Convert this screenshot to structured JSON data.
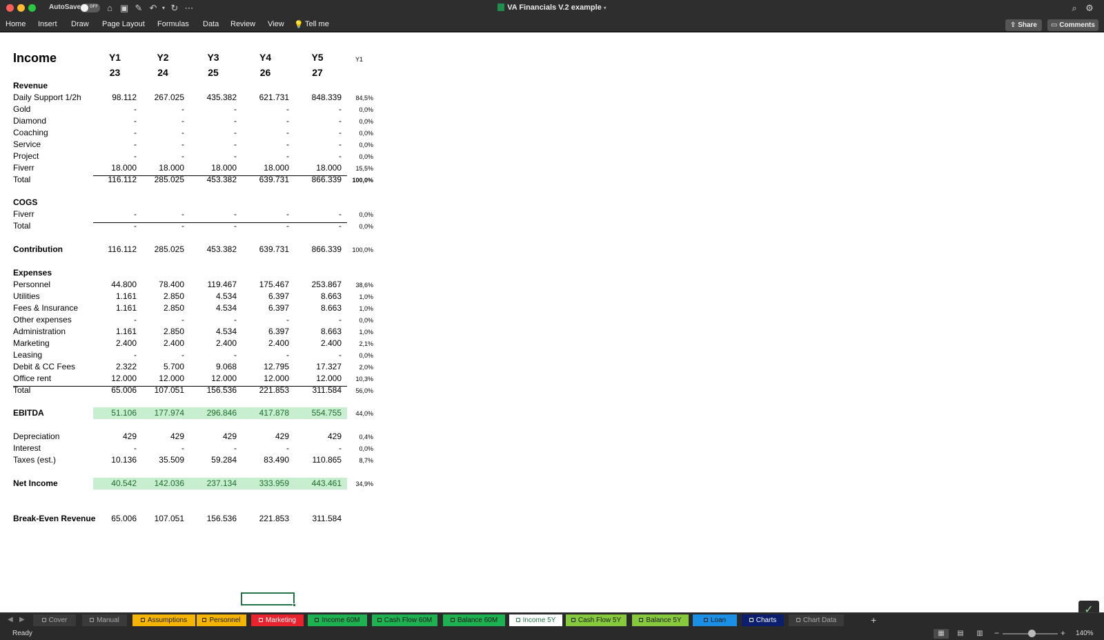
{
  "window": {
    "title": "VA Financials V.2 example",
    "autosave_label": "AutoSave",
    "autosave_state": "OFF"
  },
  "ribbon": {
    "menu": [
      "Home",
      "Insert",
      "Draw",
      "Page Layout",
      "Formulas",
      "Data",
      "Review",
      "View",
      "Tell me"
    ],
    "share_label": "Share",
    "comments_label": "Comments"
  },
  "sheet": {
    "title": "Income",
    "year_headers": [
      "Y1",
      "Y2",
      "Y3",
      "Y4",
      "Y5"
    ],
    "years": [
      "23",
      "24",
      "25",
      "26",
      "27"
    ],
    "pct_header": "Y1",
    "sections": {
      "revenue": "Revenue",
      "cogs": "COGS",
      "contribution": "Contribution",
      "expenses": "Expenses",
      "ebitda": "EBITDA",
      "net_income": "Net Income",
      "break_even": "Break-Even Revenue"
    },
    "rows": [
      {
        "label": "Daily Support 1/2h",
        "values": [
          "98.112",
          "267.025",
          "435.382",
          "621.731",
          "848.339"
        ],
        "pct": "84,5%"
      },
      {
        "label": "Gold",
        "values": [
          "-",
          "-",
          "-",
          "-",
          "-"
        ],
        "pct": "0,0%"
      },
      {
        "label": "Diamond",
        "values": [
          "-",
          "-",
          "-",
          "-",
          "-"
        ],
        "pct": "0,0%"
      },
      {
        "label": "Coaching",
        "values": [
          "-",
          "-",
          "-",
          "-",
          "-"
        ],
        "pct": "0,0%"
      },
      {
        "label": "Service",
        "values": [
          "-",
          "-",
          "-",
          "-",
          "-"
        ],
        "pct": "0,0%"
      },
      {
        "label": "Project",
        "values": [
          "-",
          "-",
          "-",
          "-",
          "-"
        ],
        "pct": "0,0%"
      },
      {
        "label": "Fiverr",
        "values": [
          "18.000",
          "18.000",
          "18.000",
          "18.000",
          "18.000"
        ],
        "pct": "15,5%"
      },
      {
        "label": "Total",
        "values": [
          "116.112",
          "285.025",
          "453.382",
          "639.731",
          "866.339"
        ],
        "pct": "100,0%"
      },
      {
        "label": "Fiverr",
        "values": [
          "-",
          "-",
          "-",
          "-",
          "-"
        ],
        "pct": "0,0%"
      },
      {
        "label": "Total",
        "values": [
          "-",
          "-",
          "-",
          "-",
          "-"
        ],
        "pct": "0,0%"
      },
      {
        "label": "",
        "values": [
          "116.112",
          "285.025",
          "453.382",
          "639.731",
          "866.339"
        ],
        "pct": "100,0%"
      },
      {
        "label": "Personnel",
        "values": [
          "44.800",
          "78.400",
          "119.467",
          "175.467",
          "253.867"
        ],
        "pct": "38,6%"
      },
      {
        "label": "Utilities",
        "values": [
          "1.161",
          "2.850",
          "4.534",
          "6.397",
          "8.663"
        ],
        "pct": "1,0%"
      },
      {
        "label": "Fees & Insurance",
        "values": [
          "1.161",
          "2.850",
          "4.534",
          "6.397",
          "8.663"
        ],
        "pct": "1,0%"
      },
      {
        "label": "Other expenses",
        "values": [
          "-",
          "-",
          "-",
          "-",
          "-"
        ],
        "pct": "0,0%"
      },
      {
        "label": "Administration",
        "values": [
          "1.161",
          "2.850",
          "4.534",
          "6.397",
          "8.663"
        ],
        "pct": "1,0%"
      },
      {
        "label": "Marketing",
        "values": [
          "2.400",
          "2.400",
          "2.400",
          "2.400",
          "2.400"
        ],
        "pct": "2,1%"
      },
      {
        "label": "Leasing",
        "values": [
          "-",
          "-",
          "-",
          "-",
          "-"
        ],
        "pct": "0,0%"
      },
      {
        "label": "Debit & CC Fees",
        "values": [
          "2.322",
          "5.700",
          "9.068",
          "12.795",
          "17.327"
        ],
        "pct": "2,0%"
      },
      {
        "label": "Office rent",
        "values": [
          "12.000",
          "12.000",
          "12.000",
          "12.000",
          "12.000"
        ],
        "pct": "10,3%"
      },
      {
        "label": "Total",
        "values": [
          "65.006",
          "107.051",
          "156.536",
          "221.853",
          "311.584"
        ],
        "pct": "56,0%"
      },
      {
        "label": "",
        "values": [
          "51.106",
          "177.974",
          "296.846",
          "417.878",
          "554.755"
        ],
        "pct": "44,0%"
      },
      {
        "label": "Depreciation",
        "values": [
          "429",
          "429",
          "429",
          "429",
          "429"
        ],
        "pct": "0,4%"
      },
      {
        "label": "Interest",
        "values": [
          "-",
          "-",
          "-",
          "-",
          "-"
        ],
        "pct": "0,0%"
      },
      {
        "label": "Taxes (est.)",
        "values": [
          "10.136",
          "35.509",
          "59.284",
          "83.490",
          "110.865"
        ],
        "pct": "8,7%"
      },
      {
        "label": "",
        "values": [
          "40.542",
          "142.036",
          "237.134",
          "333.959",
          "443.461"
        ],
        "pct": "34,9%"
      },
      {
        "label": "",
        "values": [
          "65.006",
          "107.051",
          "156.536",
          "221.853",
          "311.584"
        ],
        "pct": ""
      }
    ]
  },
  "sheet_tabs": [
    {
      "label": "Cover",
      "color": "#3a3a3a"
    },
    {
      "label": "Manual",
      "color": "#3a3a3a"
    },
    {
      "label": "Assumptions",
      "color": "#f4b400"
    },
    {
      "label": "Personnel",
      "color": "#f4b400"
    },
    {
      "label": "Marketing",
      "color": "#e8232e"
    },
    {
      "label": "Income 60M",
      "color": "#1eb152"
    },
    {
      "label": "Cash Flow 60M",
      "color": "#1eb152"
    },
    {
      "label": "Balance 60M",
      "color": "#1eb152"
    },
    {
      "label": "Income 5Y",
      "color": "#ffffff"
    },
    {
      "label": "Cash Flow 5Y",
      "color": "#86c93d"
    },
    {
      "label": "Balance 5Y",
      "color": "#86c93d"
    },
    {
      "label": "Loan",
      "color": "#1a8fe3"
    },
    {
      "label": "Charts",
      "color": "#0b1f6e"
    },
    {
      "label": "Chart Data",
      "color": "#3a3a3a"
    }
  ],
  "status": {
    "text": "Ready",
    "zoom": "140%"
  }
}
